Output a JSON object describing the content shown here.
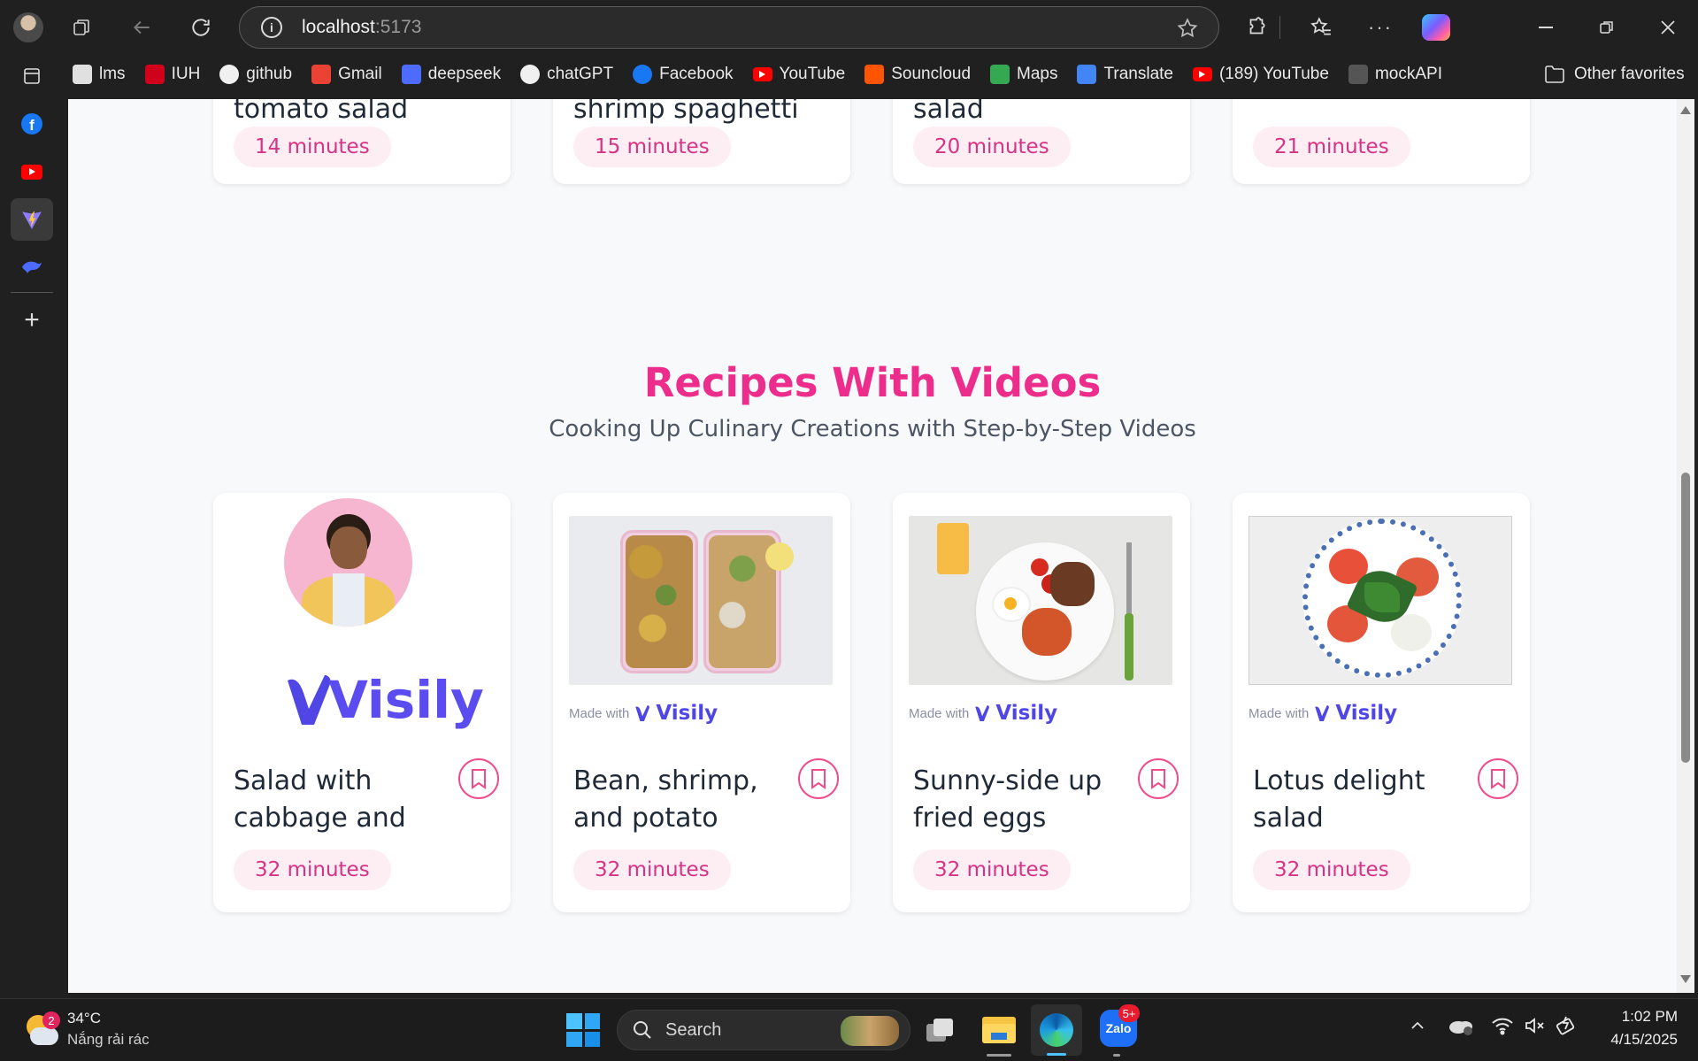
{
  "browser": {
    "address_host": "localhost",
    "address_port": ":5173",
    "bookmarks": [
      {
        "label": "lms",
        "icon": "lms-icon",
        "color": "#e0e0e0"
      },
      {
        "label": "IUH",
        "icon": "iuh-icon",
        "color": "#d0021b"
      },
      {
        "label": "github",
        "icon": "github-icon",
        "color": "#ffffff"
      },
      {
        "label": "Gmail",
        "icon": "gmail-icon",
        "color": "#ea4335"
      },
      {
        "label": "deepseek",
        "icon": "deepseek-icon",
        "color": "#4d6bfe"
      },
      {
        "label": "chatGPT",
        "icon": "chatgpt-icon",
        "color": "#ffffff"
      },
      {
        "label": "Facebook",
        "icon": "facebook-icon",
        "color": "#1877f2"
      },
      {
        "label": "YouTube",
        "icon": "youtube-icon",
        "color": "#ff0000"
      },
      {
        "label": "Souncloud",
        "icon": "soundcloud-icon",
        "color": "#ff5500"
      },
      {
        "label": "Maps",
        "icon": "maps-icon",
        "color": "#34a853"
      },
      {
        "label": "Translate",
        "icon": "translate-icon",
        "color": "#4285f4"
      },
      {
        "label": "(189) YouTube",
        "icon": "youtube-icon",
        "color": "#ff0000"
      },
      {
        "label": "mockAPI",
        "icon": "mockapi-icon",
        "color": "#555555"
      }
    ],
    "other_favorites": "Other favorites"
  },
  "top_cards": [
    {
      "title": "tomato salad",
      "time": "14 minutes"
    },
    {
      "title": "shrimp spaghetti",
      "time": "15 minutes"
    },
    {
      "title": "salad",
      "time": "20 minutes"
    },
    {
      "title": "",
      "time": "21 minutes"
    }
  ],
  "section": {
    "title": "Recipes With Videos",
    "subtitle": "Cooking Up Culinary Creations with Step-by-Step Videos"
  },
  "video_cards": [
    {
      "title": "Salad with cabbage and",
      "time": "32 minutes",
      "image": "avatar-with-visily-logo"
    },
    {
      "title": "Bean, shrimp, and potato salad",
      "time": "32 minutes",
      "image": "bean-shrimp-salad-photo",
      "made_with": "Made with",
      "brand": "Visily"
    },
    {
      "title": "Sunny-side up fried eggs",
      "time": "32 minutes",
      "image": "fried-eggs-photo",
      "made_with": "Made with",
      "brand": "Visily"
    },
    {
      "title": "Lotus delight salad",
      "time": "32 minutes",
      "image": "lotus-salad-photo",
      "made_with": "Made with",
      "brand": "Visily"
    }
  ],
  "first_card_brand": "Visily",
  "taskbar": {
    "weather_temp": "34°C",
    "weather_desc": "Nắng rải rác",
    "weather_badge": "2",
    "search_label": "Search",
    "zalo_badge": "5+",
    "zalo_label": "Zalo",
    "time": "1:02 PM",
    "date": "4/15/2025"
  },
  "colors": {
    "accent_pink": "#ec2d8c",
    "pill_bg": "#fdeef4",
    "pill_text": "#d63384"
  }
}
